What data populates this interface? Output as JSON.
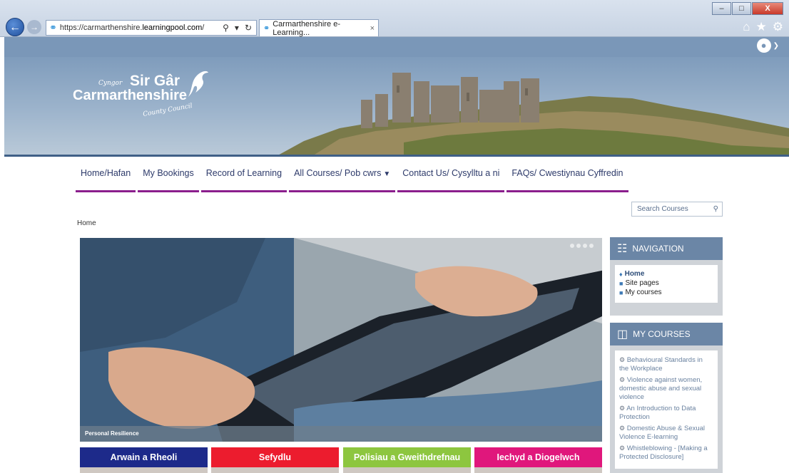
{
  "browser": {
    "url_prefix": "https://carmarthenshire.",
    "url_domain": "learningpool.com",
    "url_suffix": "/",
    "tab_title": "Carmarthenshire e-Learning...",
    "tab_close": "×",
    "window_buttons": [
      "–",
      "□",
      "X"
    ],
    "icons": [
      "home-icon",
      "star-icon",
      "gear-icon"
    ]
  },
  "header": {
    "logo": {
      "cyngor": "Cyngor",
      "sir_gar": "Sir Gâr",
      "carmarthenshire": "Carmarthenshire",
      "county_council": "County Council"
    }
  },
  "menu": {
    "items": [
      {
        "label": "Home/Hafan"
      },
      {
        "label": "My Bookings"
      },
      {
        "label": "Record of Learning"
      },
      {
        "label": "All Courses/ Pob cwrs"
      },
      {
        "label": "Contact Us/ Cysylltu a ni"
      },
      {
        "label": "FAQs/ Cwestiynau Cyffredin"
      }
    ]
  },
  "search": {
    "placeholder": "Search Courses"
  },
  "breadcrumb": "Home",
  "slider": {
    "caption": "Personal Resilience"
  },
  "categories": [
    {
      "label": "Arwain a Rheoli",
      "color": "#1d2a8a"
    },
    {
      "label": "Sefydlu",
      "color": "#ec1c2e"
    },
    {
      "label": "Polisiau a Gweithdrefnau",
      "color": "#8dc63f"
    },
    {
      "label": "Iechyd a Diogelwch",
      "color": "#e0177c"
    }
  ],
  "navigation_block": {
    "title": "NAVIGATION",
    "items": [
      {
        "label": "Home"
      },
      {
        "label": "Site pages"
      },
      {
        "label": "My courses"
      }
    ]
  },
  "my_courses_block": {
    "title": "MY COURSES",
    "items": [
      {
        "label": "Behavioural Standards in the Workplace"
      },
      {
        "label": "Violence against women, domestic abuse and sexual violence"
      },
      {
        "label": "An Introduction to Data Protection"
      },
      {
        "label": "Domestic Abuse & Sexual Violence E-learning"
      },
      {
        "label": "Whistleblowing - [Making a Protected Disclosure]"
      }
    ]
  },
  "colors": {
    "menu_underline": "#8b1e8d",
    "block_header": "#6b86a6",
    "banner_border": "#3f5f87"
  }
}
